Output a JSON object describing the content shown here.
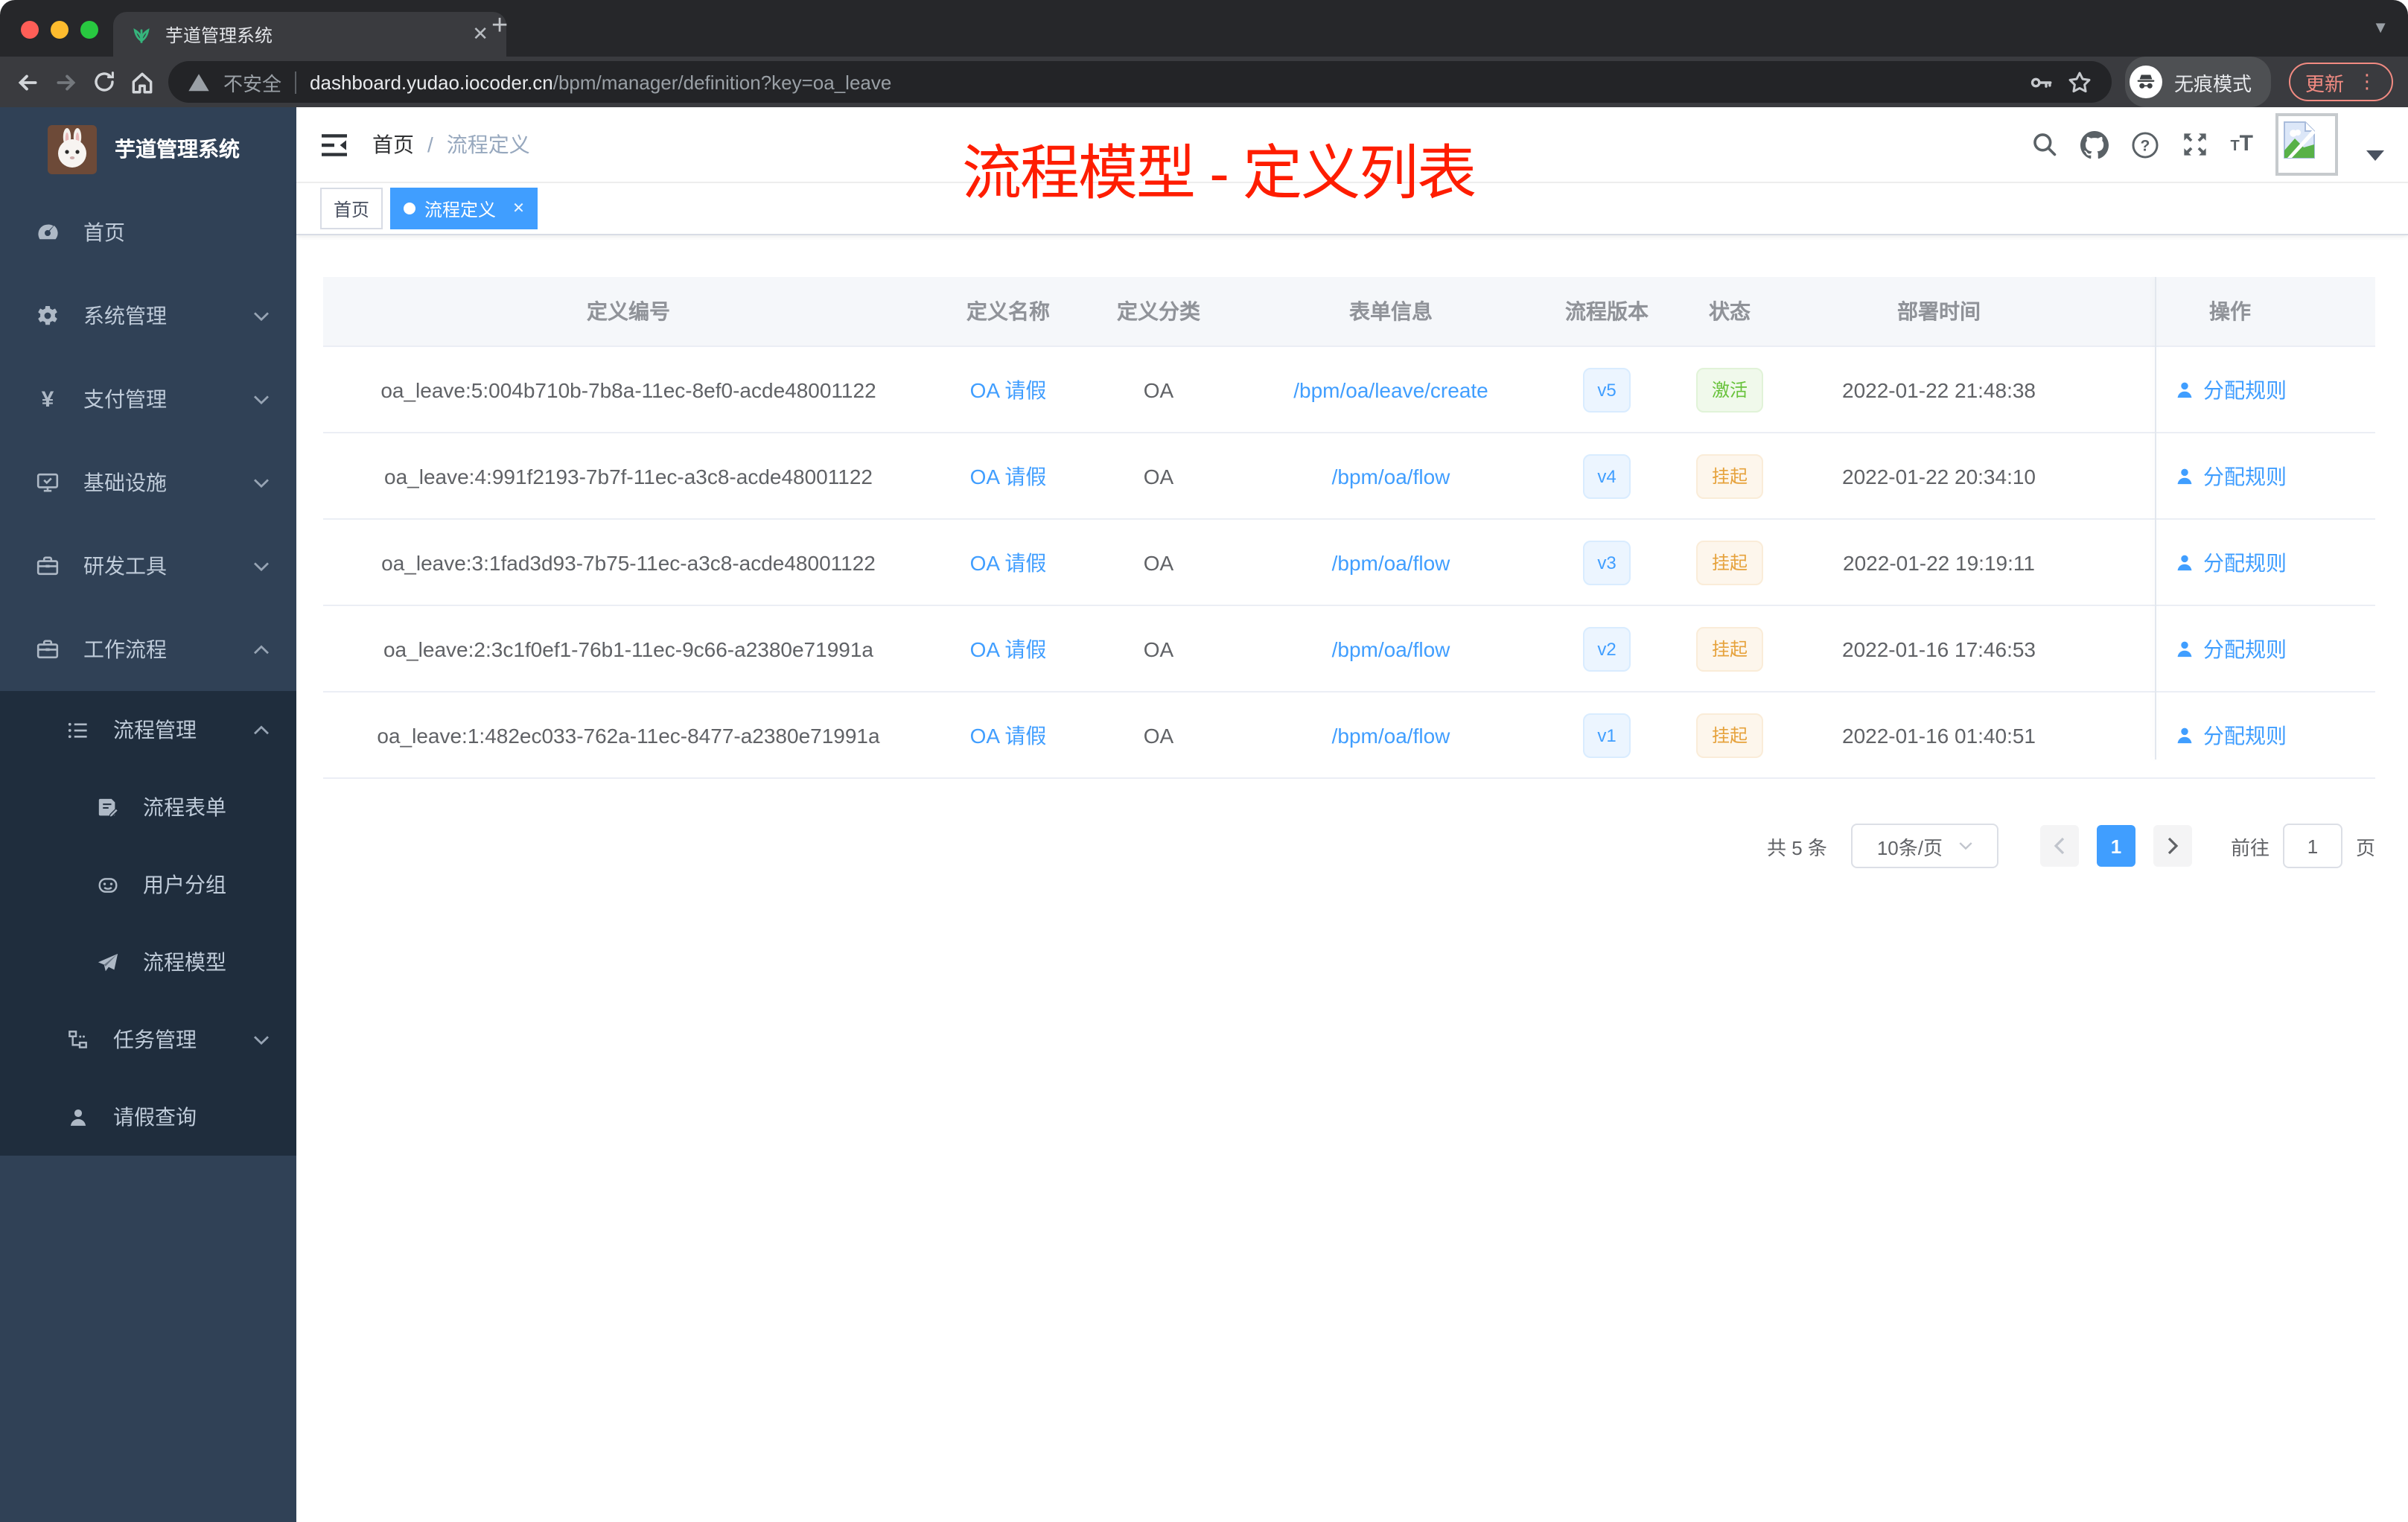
{
  "browser": {
    "tab_title": "芋道管理系统",
    "security_label": "不安全",
    "url_domain": "dashboard.yudao.iocoder.cn",
    "url_path": "/bpm/manager/definition?key=oa_leave",
    "incognito_label": "无痕模式",
    "update_label": "更新"
  },
  "sidebar": {
    "app_title": "芋道管理系统",
    "items": [
      {
        "label": "首页"
      },
      {
        "label": "系统管理",
        "chevron": "down"
      },
      {
        "label": "支付管理",
        "chevron": "down"
      },
      {
        "label": "基础设施",
        "chevron": "down"
      },
      {
        "label": "研发工具",
        "chevron": "down"
      },
      {
        "label": "工作流程",
        "chevron": "up"
      },
      {
        "label": "流程管理",
        "chevron": "up"
      },
      {
        "label": "流程表单"
      },
      {
        "label": "用户分组"
      },
      {
        "label": "流程模型"
      },
      {
        "label": "任务管理",
        "chevron": "down"
      },
      {
        "label": "请假查询"
      }
    ]
  },
  "header": {
    "breadcrumb_home": "首页",
    "breadcrumb_sep": "/",
    "breadcrumb_current": "流程定义",
    "annotation": "流程模型 - 定义列表"
  },
  "tags": [
    {
      "label": "首页",
      "active": false
    },
    {
      "label": "流程定义",
      "active": true
    }
  ],
  "table": {
    "columns": [
      {
        "label": "定义编号"
      },
      {
        "label": "定义名称"
      },
      {
        "label": "定义分类"
      },
      {
        "label": "表单信息"
      },
      {
        "label": "流程版本"
      },
      {
        "label": "状态"
      },
      {
        "label": "部署时间"
      },
      {
        "label": "操作"
      }
    ],
    "rows": [
      {
        "id": "oa_leave:5:004b710b-7b8a-11ec-8ef0-acde48001122",
        "name": "OA 请假",
        "category": "OA",
        "form": "/bpm/oa/leave/create",
        "version": "v5",
        "status": "激活",
        "status_type": "success",
        "deploy_time": "2022-01-22 21:48:38",
        "action": "分配规则"
      },
      {
        "id": "oa_leave:4:991f2193-7b7f-11ec-a3c8-acde48001122",
        "name": "OA 请假",
        "category": "OA",
        "form": "/bpm/oa/flow",
        "version": "v4",
        "status": "挂起",
        "status_type": "warning",
        "deploy_time": "2022-01-22 20:34:10",
        "action": "分配规则"
      },
      {
        "id": "oa_leave:3:1fad3d93-7b75-11ec-a3c8-acde48001122",
        "name": "OA 请假",
        "category": "OA",
        "form": "/bpm/oa/flow",
        "version": "v3",
        "status": "挂起",
        "status_type": "warning",
        "deploy_time": "2022-01-22 19:19:11",
        "action": "分配规则"
      },
      {
        "id": "oa_leave:2:3c1f0ef1-76b1-11ec-9c66-a2380e71991a",
        "name": "OA 请假",
        "category": "OA",
        "form": "/bpm/oa/flow",
        "version": "v2",
        "status": "挂起",
        "status_type": "warning",
        "deploy_time": "2022-01-16 17:46:53",
        "action": "分配规则"
      },
      {
        "id": "oa_leave:1:482ec033-762a-11ec-8477-a2380e71991a",
        "name": "OA 请假",
        "category": "OA",
        "form": "/bpm/oa/flow",
        "version": "v1",
        "status": "挂起",
        "status_type": "warning",
        "deploy_time": "2022-01-16 01:40:51",
        "action": "分配规则"
      }
    ]
  },
  "pagination": {
    "total_label": "共 5 条",
    "page_size": "10条/页",
    "current_page": "1",
    "goto_label": "前往",
    "goto_value": "1",
    "page_unit": "页"
  },
  "colors": {
    "accent": "#409eff",
    "success": "#67c23a",
    "warning": "#e6a23c",
    "annotation_red": "#fe1d00",
    "sidebar_bg": "#304156",
    "submenu_bg": "#1f2d3d"
  }
}
